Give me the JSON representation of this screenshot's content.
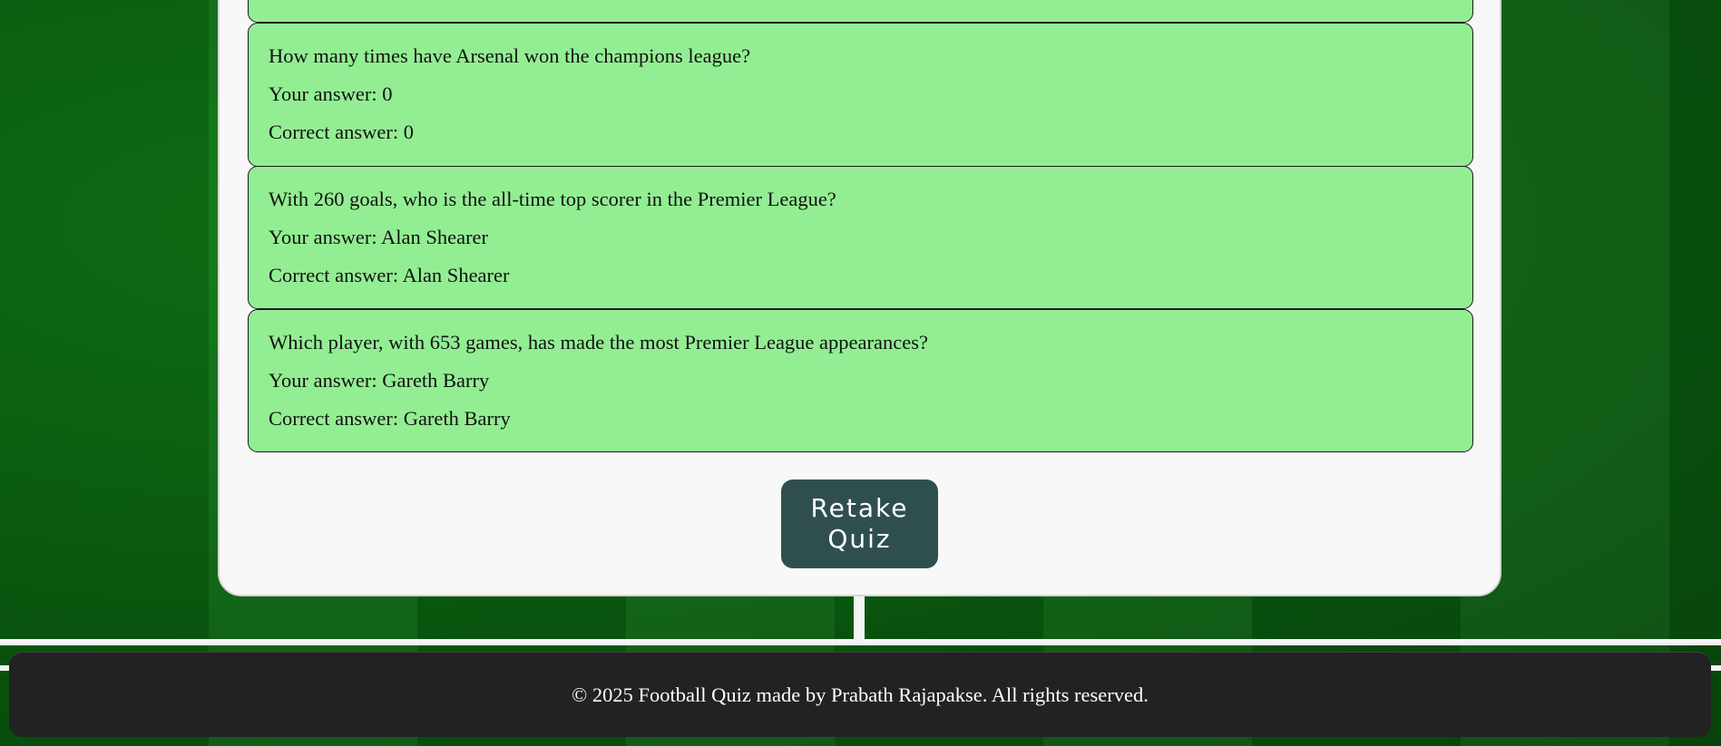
{
  "results": [
    {
      "question": "",
      "your_answer": "",
      "correct_answer": ""
    },
    {
      "question": "How many times have Arsenal won the champions league?",
      "your_answer": "Your answer: 0",
      "correct_answer": "Correct answer: 0"
    },
    {
      "question": "With 260 goals, who is the all-time top scorer in the Premier League?",
      "your_answer": "Your answer: Alan Shearer",
      "correct_answer": "Correct answer: Alan Shearer"
    },
    {
      "question": "Which player, with 653 games, has made the most Premier League appearances?",
      "your_answer": "Your answer: Gareth Barry",
      "correct_answer": "Correct answer: Gareth Barry"
    }
  ],
  "retake_button": {
    "label": "Retake Quiz"
  },
  "footer": {
    "text": "© 2025 Football Quiz made by Prabath Rajapakse. All rights reserved."
  },
  "colors": {
    "correct_bg": "#93ee93",
    "button_bg": "#2f4f4f",
    "footer_bg": "#222222",
    "card_bg": "#f8f8f8"
  }
}
